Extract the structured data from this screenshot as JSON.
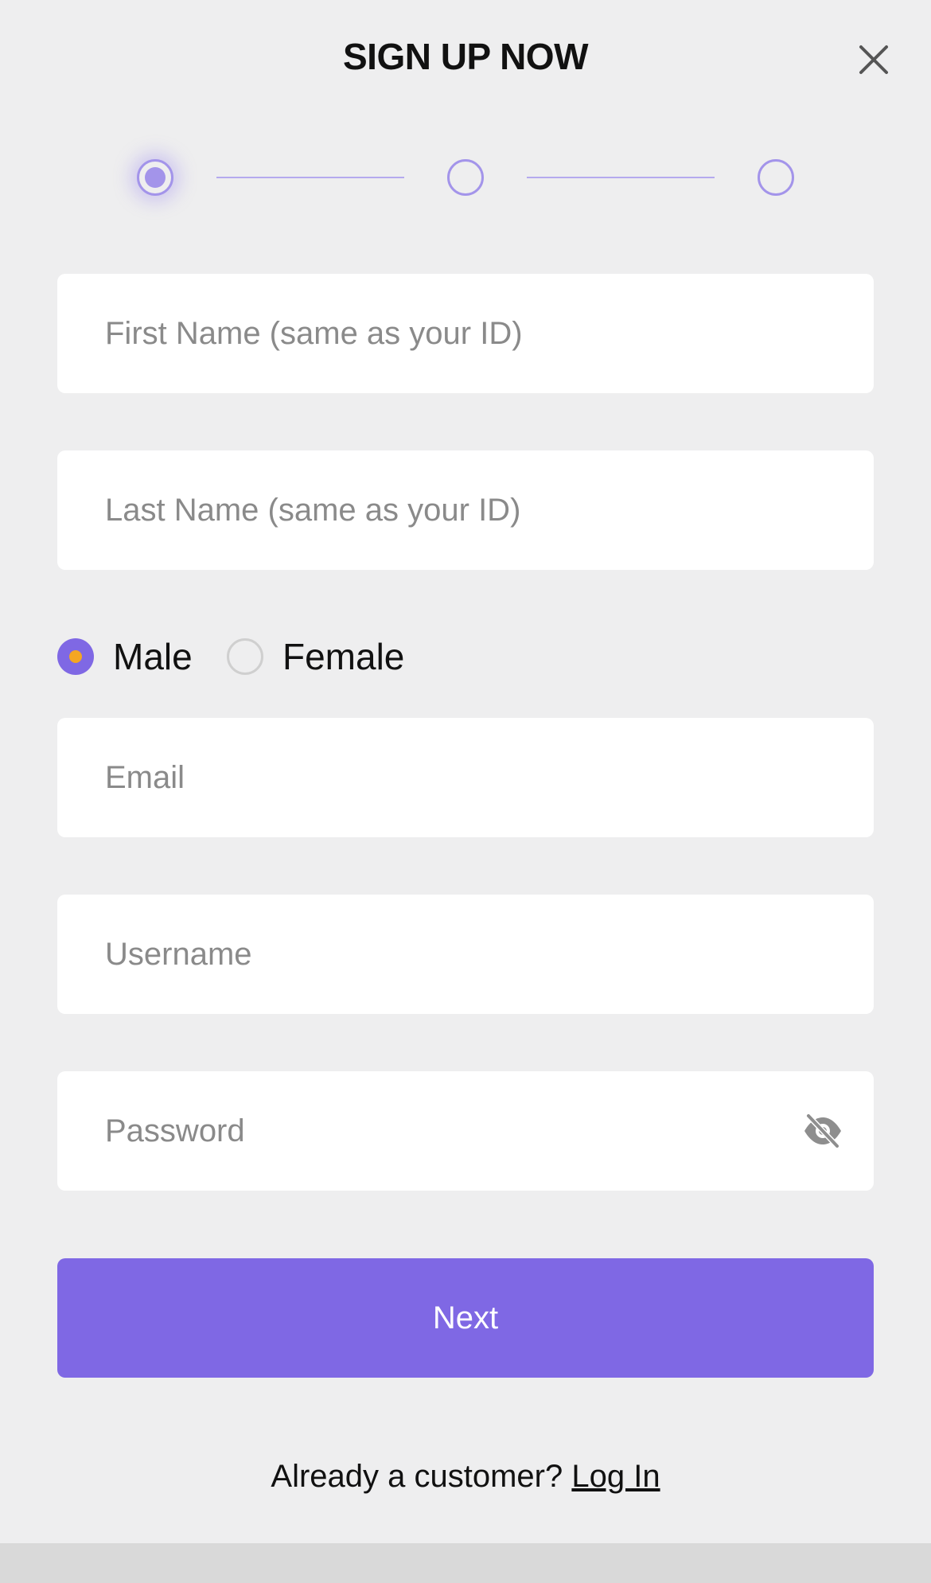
{
  "header": {
    "title": "SIGN UP NOW",
    "close_icon": "close-icon"
  },
  "stepper": {
    "current_step": 1,
    "total_steps": 3
  },
  "form": {
    "first_name": {
      "value": "",
      "placeholder": "First Name (same as your ID)"
    },
    "last_name": {
      "value": "",
      "placeholder": "Last Name (same as your ID)"
    },
    "gender": {
      "options": [
        {
          "label": "Male",
          "selected": true
        },
        {
          "label": "Female",
          "selected": false
        }
      ]
    },
    "email": {
      "value": "",
      "placeholder": "Email"
    },
    "username": {
      "value": "",
      "placeholder": "Username"
    },
    "password": {
      "value": "",
      "placeholder": "Password",
      "toggle_icon": "eye-off-icon"
    }
  },
  "actions": {
    "next_label": "Next"
  },
  "footer": {
    "prompt": "Already a customer?",
    "login_label": "Log In"
  },
  "colors": {
    "accent": "#7f68e4",
    "step_color": "#a394ea",
    "radio_dot": "#f5a623",
    "background": "#eeeeef"
  }
}
